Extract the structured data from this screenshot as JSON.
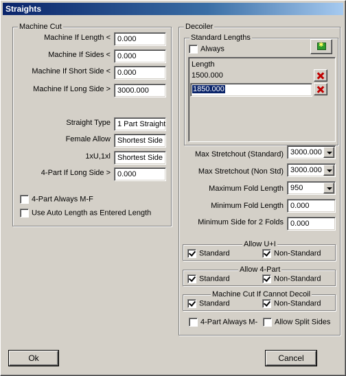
{
  "window": {
    "title": "Straights"
  },
  "machine_cut": {
    "title": "Machine Cut",
    "if_length_label": "Machine If Length <",
    "if_length_value": "0.000",
    "if_sides_label": "Machine If Sides <",
    "if_sides_value": "0.000",
    "if_short_side_label": "Machine If Short Side <",
    "if_short_side_value": "0.000",
    "if_long_side_label": "Machine If Long Side >",
    "if_long_side_value": "3000.000",
    "straight_type_label": "Straight Type",
    "straight_type_value": "1 Part Straight",
    "female_allow_label": "Female Allow",
    "female_allow_value": "Shortest Side",
    "ux_label": "1xU,1xl",
    "ux_value": "Shortest Side",
    "four_part_label": "4-Part If Long Side >",
    "four_part_value": "0.000",
    "four_part_always_mf": "4-Part Always M-F",
    "use_auto_length": "Use Auto Length as Entered Length"
  },
  "decoiler": {
    "title": "Decoiler",
    "standard_lengths_title": "Standard Lengths",
    "always_label": "Always",
    "length_header": "Length",
    "lengths": [
      "1500.000",
      "1850.000"
    ],
    "max_stretch_std_label": "Max Stretchout (Standard)",
    "max_stretch_std_value": "3000.000",
    "max_stretch_nonstd_label": "Max Stretchout (Non Std)",
    "max_stretch_nonstd_value": "3000.000",
    "max_fold_label": "Maximum Fold Length",
    "max_fold_value": "950",
    "min_fold_label": "Minimum Fold Length",
    "min_fold_value": "0.000",
    "min_side_label": "Minimum Side for 2 Folds",
    "min_side_value": "0.000",
    "allow_ui_title": "Allow U+I",
    "allow_4part_title": "Allow 4-Part",
    "machine_cut_title": "Machine Cut If Cannot Decoil",
    "standard_label": "Standard",
    "non_standard_label": "Non-Standard",
    "four_part_always": "4-Part Always M-",
    "allow_split_sides": "Allow Split Sides"
  },
  "buttons": {
    "ok": "Ok",
    "cancel": "Cancel"
  },
  "colors": {
    "title_start": "#0a246a",
    "title_end": "#a6caf0",
    "delete_icon": "#c00000"
  }
}
